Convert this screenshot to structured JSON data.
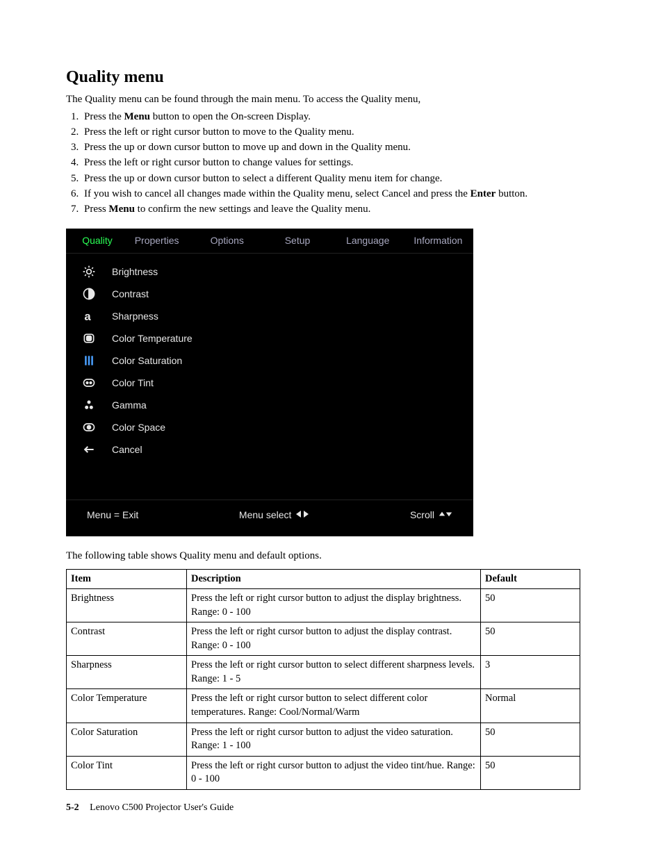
{
  "title": "Quality menu",
  "intro": "The Quality menu can be found through the main menu. To access the Quality menu,",
  "steps": [
    {
      "pre": "Press the ",
      "bold": "Menu",
      "post": " button to open the On-screen Display."
    },
    {
      "pre": "Press the left or right cursor button to move to the Quality menu.",
      "bold": "",
      "post": ""
    },
    {
      "pre": "Press the up or down cursor button to move up and down in the Quality menu.",
      "bold": "",
      "post": ""
    },
    {
      "pre": "Press the left or right cursor button to change values for settings.",
      "bold": "",
      "post": ""
    },
    {
      "pre": "Press the up or down cursor button to select a different Quality menu item for change.",
      "bold": "",
      "post": ""
    },
    {
      "pre": "If you wish to cancel all changes made within the Quality menu, select Cancel and press the ",
      "bold": "Enter",
      "post": " button."
    },
    {
      "pre": "Press ",
      "bold": "Menu",
      "post": " to confirm the new settings and leave the Quality menu."
    }
  ],
  "osd": {
    "tabs": [
      "Quality",
      "Properties",
      "Options",
      "Setup",
      "Language",
      "Information"
    ],
    "items": [
      "Brightness",
      "Contrast",
      "Sharpness",
      "Color Temperature",
      "Color Saturation",
      "Color Tint",
      "Gamma",
      "Color Space",
      "Cancel"
    ],
    "footer": {
      "exit": "Menu = Exit",
      "select": "Menu select",
      "scroll": "Scroll"
    }
  },
  "table_caption": "The following table shows Quality menu and default options.",
  "headers": {
    "item": "Item",
    "desc": "Description",
    "def": "Default"
  },
  "rows": [
    {
      "item": "Brightness",
      "desc": "Press the left or right cursor button to adjust the display brightness. Range: 0 - 100",
      "def": "50"
    },
    {
      "item": "Contrast",
      "desc": "Press the left or right cursor button to adjust the display contrast. Range: 0 - 100",
      "def": "50"
    },
    {
      "item": "Sharpness",
      "desc": "Press the left or right cursor button to select different sharpness levels. Range: 1 - 5",
      "def": "3"
    },
    {
      "item": "Color Temperature",
      "desc": "Press the left or right cursor button to select different color temperatures. Range: Cool/Normal/Warm",
      "def": "Normal"
    },
    {
      "item": "Color Saturation",
      "desc": "Press the left or right cursor button to adjust the video saturation. Range: 1 - 100",
      "def": "50"
    },
    {
      "item": "Color Tint",
      "desc": "Press the left or right cursor button to adjust the video tint/hue. Range: 0 - 100",
      "def": "50"
    }
  ],
  "footer": {
    "page": "5-2",
    "book": "Lenovo C500 Projector User's Guide"
  }
}
